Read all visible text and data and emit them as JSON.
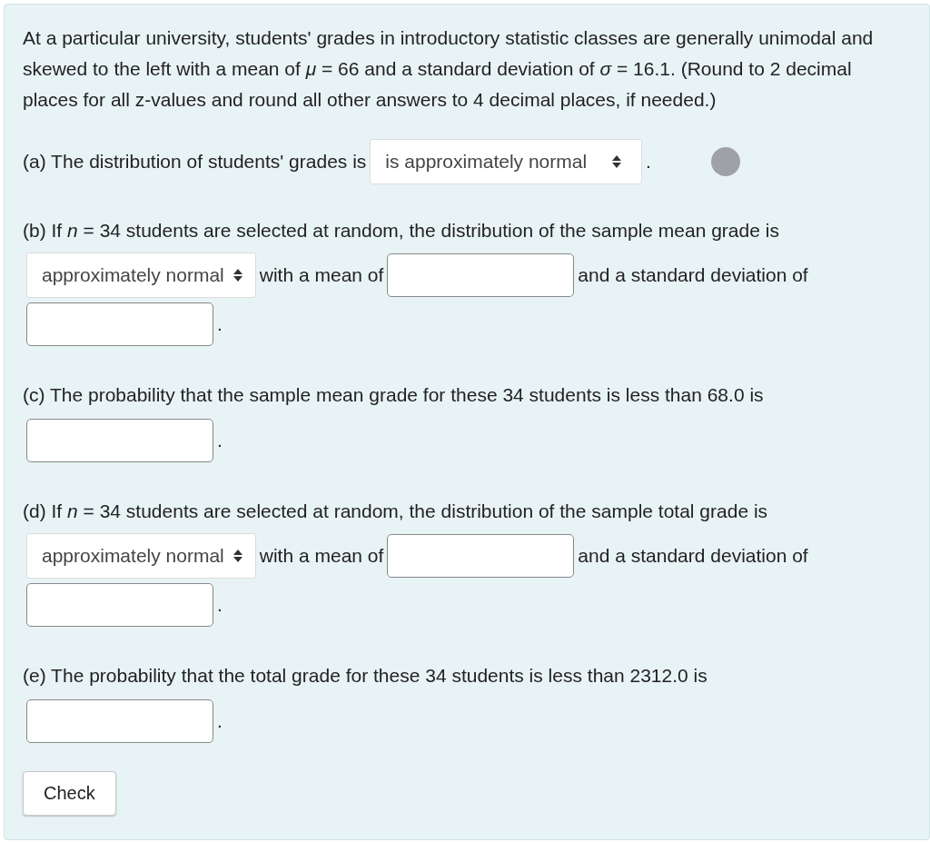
{
  "intro": "At a particular university, students' grades in introductory statistic classes are generally unimodal and skewed to the left with a mean of *μ* = 66 and a standard deviation of *σ* = 16.1. (Round to 2 decimal places for all z-values and round all other answers to 4 decimal places, if needed.)",
  "parts": [
    {
      "segments": [
        {
          "kind": "text",
          "text": "(a) The distribution of students' grades is"
        },
        {
          "kind": "select",
          "value": "is approximately normal"
        },
        {
          "kind": "text",
          "text": "."
        },
        {
          "kind": "status"
        }
      ]
    },
    {
      "segments": [
        {
          "kind": "text",
          "text": "(b) If *n* = 34 students are selected at random, the distribution of the sample mean grade is"
        },
        {
          "kind": "select",
          "value": "approximately normal"
        },
        {
          "kind": "text",
          "text": "with a mean of"
        },
        {
          "kind": "input"
        },
        {
          "kind": "text",
          "text": "and a standard deviation of"
        },
        {
          "kind": "input"
        },
        {
          "kind": "text",
          "text": "."
        }
      ]
    },
    {
      "segments": [
        {
          "kind": "text",
          "text": "(c) The probability that the sample mean grade for these 34 students is less than 68.0 is"
        },
        {
          "kind": "input"
        },
        {
          "kind": "text",
          "text": "."
        }
      ]
    },
    {
      "segments": [
        {
          "kind": "text",
          "text": "(d) If *n* = 34 students are selected at random, the distribution of the sample total grade is"
        },
        {
          "kind": "select",
          "value": "approximately normal"
        },
        {
          "kind": "text",
          "text": "with a mean of"
        },
        {
          "kind": "input"
        },
        {
          "kind": "text",
          "text": "and a standard deviation of"
        },
        {
          "kind": "input"
        },
        {
          "kind": "text",
          "text": "."
        }
      ]
    },
    {
      "segments": [
        {
          "kind": "text",
          "text": "(e) The probability that the total grade for these 34 students is less than 2312.0 is"
        },
        {
          "kind": "input"
        },
        {
          "kind": "text",
          "text": "."
        }
      ]
    }
  ],
  "button": "Check"
}
